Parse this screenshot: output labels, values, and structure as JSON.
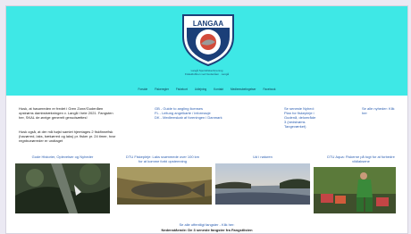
{
  "header": {
    "logo_top_text": "LANGAA",
    "logo_ring_text": "SPORTSFISKERFORENING",
    "sub1": "Langå Sportsfiskerforening",
    "sub2": "Fiskeklubben ved Gudenåen · Langå",
    "nav": [
      "Forside",
      "Fiskeregler",
      "Fiskekort",
      "Udlejning",
      "Kontakt",
      "Medlemsbetingelser",
      "Facebook"
    ]
  },
  "intro": {
    "p1": [
      "Husk, at havørreden er fredet i Gren Zone/Gudenåen",
      "opstrøms dambstrækningen v. Langå i hele 2021. Fangsten",
      "her, SKAL de øvrige generelt genudsættes!"
    ],
    "p2": [
      "Husk også, at der må højst samlet hjemtages 2 fiskfinnefisk",
      "(havørred, laks, bækørred og laks) pr. fisker pr. 24 timer, hvor",
      "regnbueørreder er undtaget"
    ]
  },
  "guides": [
    "GB - Guide to angling licenses",
    "FL - Leitung angelkarte / informacje",
    "DK - Medlemskab af foreningen i Danmark"
  ],
  "news": {
    "lines": [
      "Se seneste Nyhed:",
      "Plan for fiskepleje i",
      "Gudenå, delområde",
      "3 (nedstrøms",
      "Tangeværket)"
    ],
    "all": [
      "Se alle nyheder: Klik",
      "her"
    ]
  },
  "cards": [
    {
      "caption": [
        "Gode Historier, Oplevelser og Nyheder"
      ]
    },
    {
      "caption": [
        "DTU Fiskepleje: Laks svømmede over 100 km",
        "for at komme forbi opstemning"
      ]
    },
    {
      "caption": [
        "Ud i naturen"
      ]
    },
    {
      "caption": [
        "DTU Aqua: Fiskerne på togt for at forbedre",
        "vildlaksene"
      ]
    }
  ],
  "bottom": {
    "link": "Se alle offentligt fangster - Klik her:",
    "bold": "Nedenstående: De 3 seneste fangster fra Fangstlisten"
  },
  "colors": {
    "header": "#3ee8e6",
    "link": "#2a5db0",
    "background": "#ebe9f3"
  },
  "icons": [
    "shield-logo"
  ]
}
